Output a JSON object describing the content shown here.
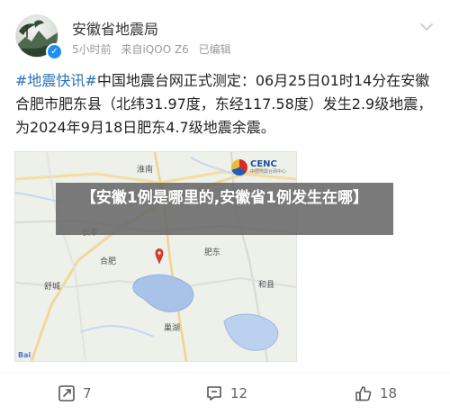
{
  "post": {
    "author": "安徽省地震局",
    "meta": {
      "time": "5小时前",
      "source": "来自iQOO Z6",
      "edited": "已编辑"
    },
    "body": {
      "hashtag": "#地震快讯#",
      "text": "中国地震台网正式测定：06月25日01时14分在安徽合肥市肥东县（北纬31.97度，东经117.58度）发生2.9级地震，为2024年9月18日肥东4.7级地震余震。"
    },
    "image": {
      "logo": "CENC",
      "logo_subtitle": "中国地震台网中心",
      "attribution": "Bai"
    },
    "overlay": "【安徽1例是哪里的,安徽省1例发生在哪】",
    "actions": {
      "repost_count": "7",
      "comment_count": "12",
      "like_count": "18"
    }
  },
  "icons": {
    "verified": "verified-badge-icon",
    "repost": "repost-icon",
    "comment": "comment-icon",
    "like": "thumbs-up-icon",
    "map_marker": "location-pin-icon"
  },
  "colors": {
    "hashtag": "#2a6fb3",
    "verified": "#1f8ff5",
    "marker": "#e13b2a",
    "overlay": "#686868"
  }
}
